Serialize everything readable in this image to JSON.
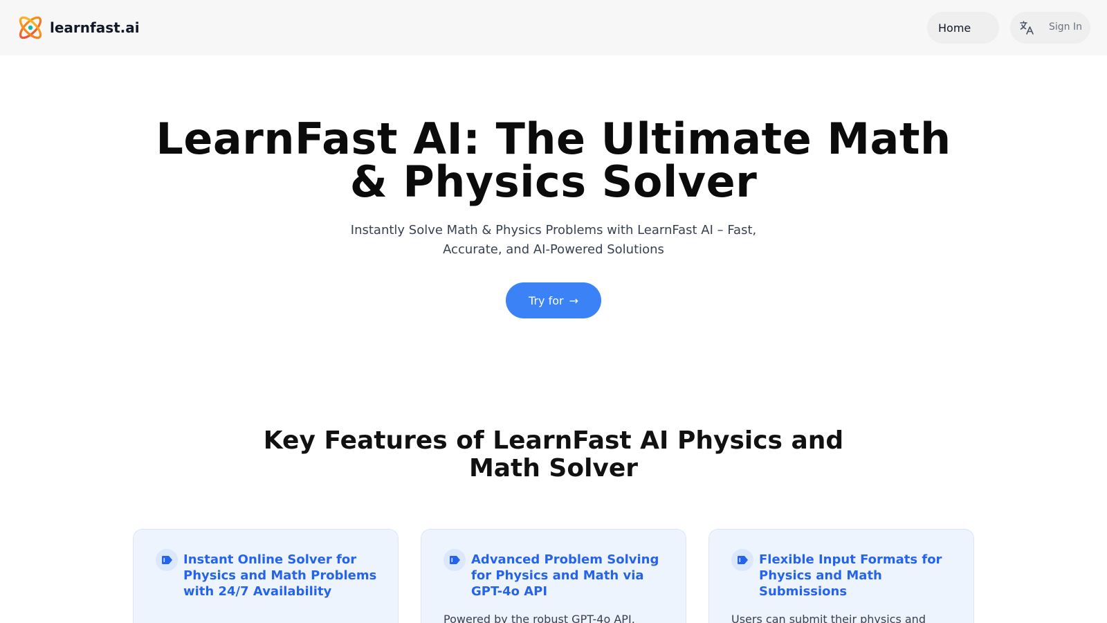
{
  "header": {
    "logo_text": "learnfast.ai",
    "nav_home": "Home",
    "sign_in": "Sign In"
  },
  "hero": {
    "title_line1": "LearnFast AI: The Ultimate Math",
    "title_line2": "& Physics Solver",
    "subtitle": "Instantly Solve Math & Physics Problems with LearnFast AI – Fast, Accurate, and AI-Powered Solutions",
    "cta_label": "Try for",
    "cta_arrow": "→"
  },
  "features": {
    "title_line1": "Key Features of LearnFast AI Physics and",
    "title_line2": "Math Solver",
    "cards": [
      {
        "title": "Instant Online Solver for Physics and Math Problems with 24/7 Availability",
        "body": ""
      },
      {
        "title": "Advanced Problem Solving for Physics and Math via GPT-4o API",
        "body": "Powered by the robust GPT-4o API,"
      },
      {
        "title": "Flexible Input Formats for Physics and Math Submissions",
        "body": "Users can submit their physics and"
      }
    ]
  },
  "colors": {
    "accent": "#3b82f6",
    "card_title": "#2563eb",
    "card_bg": "#eef4fd"
  },
  "icons": {
    "logo": "atom-logo-icon",
    "language": "translate-icon",
    "cta": "arrow-right-icon",
    "card": "tag-icon"
  }
}
